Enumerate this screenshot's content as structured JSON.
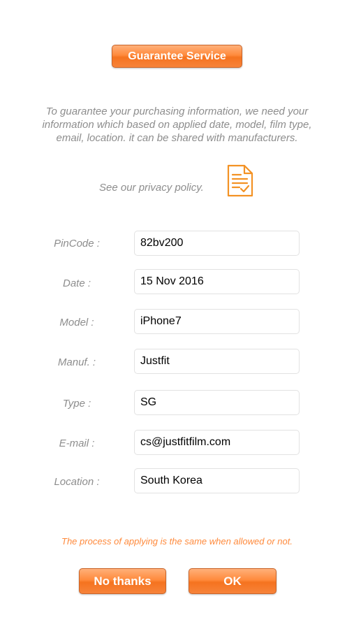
{
  "header": {
    "title_button_label": "Guarantee Service"
  },
  "intro": {
    "line1": "To guarantee your purchasing information, we need your",
    "line2": "information which based on applied date, model, film type,",
    "line3": "email, location. it can be shared with manufacturers."
  },
  "privacy": {
    "text": "See our privacy policy.",
    "icon": "document-check-icon",
    "icon_color": "#f39224"
  },
  "form": {
    "pincode": {
      "label": "PinCode :",
      "value": "82bv200"
    },
    "date": {
      "label": "Date :",
      "value": "15 Nov 2016"
    },
    "model": {
      "label": "Model :",
      "value": "iPhone7"
    },
    "manufacturer": {
      "label": "Manuf. :",
      "value": "Justfit"
    },
    "type": {
      "label": "Type :",
      "value": "SG"
    },
    "email": {
      "label": "E-mail :",
      "value": "cs@justfitfilm.com"
    },
    "location": {
      "label": "Location :",
      "value": "South Korea"
    }
  },
  "note": "The process of applying is the same when allowed or not.",
  "actions": {
    "no_thanks_label": "No thanks",
    "ok_label": "OK"
  },
  "colors": {
    "accent": "#ff8a3c",
    "muted_text": "#8d8d8d"
  }
}
